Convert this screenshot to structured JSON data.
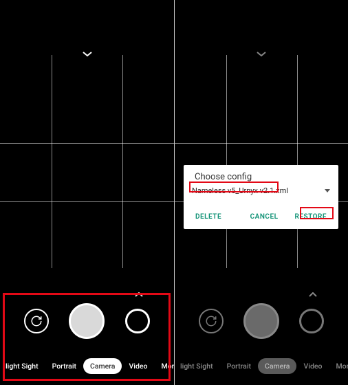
{
  "left": {
    "modes": {
      "night": "light Sight",
      "portrait": "Portrait",
      "camera": "Camera",
      "video": "Video",
      "more": "More"
    }
  },
  "right": {
    "modes": {
      "night": "light Sight",
      "portrait": "Portrait",
      "camera": "Camera",
      "video": "Video",
      "more": "More"
    }
  },
  "dialog": {
    "title": "Choose config",
    "selected": "Nameless v5_Urnyx v2.1.xml",
    "delete": "DELETE",
    "cancel": "CANCEL",
    "restore": "RESTORE"
  }
}
